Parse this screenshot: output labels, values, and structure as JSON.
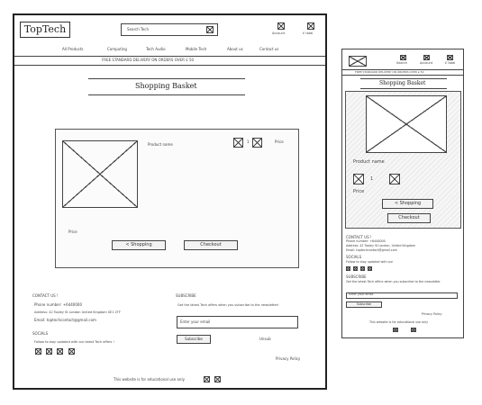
{
  "desktop": {
    "logo": "TopTech",
    "search_placeholder": "Search Tech",
    "account_label": "Account",
    "basket_label": "£ total",
    "nav": [
      "All Products",
      "Computing",
      "Tech Audio",
      "Mobile Tech",
      "About us",
      "Contact us"
    ],
    "banner": "FREE STANDARD DELIVERY ON ORDERS OVER £ 50",
    "page_title": "Shopping Basket",
    "product_name": "Product name",
    "qty_value": "1",
    "price_label": "Price",
    "price_bottom": "Price",
    "back_button": "< Shopping",
    "checkout_button": "Checkout",
    "contact_title": "CONTACT US !",
    "phone": "Phone number: +6440000",
    "address": "Address: 42 Tooley St London United Kingdom SE1 2TF",
    "email": "Email: toptechcontact@gmail.com",
    "socials_title": "SOCIALS",
    "socials_text": "Follow to stay updated with our latest Tech offers !",
    "subscribe_title": "SUBSCRIBE",
    "subscribe_text": "Get the latest Tech offers when you subscribe to the newsletter!",
    "email_placeholder": "Enter your email",
    "subscribe_button": "Subscribe",
    "unsub": "Unsub",
    "privacy": "Privacy Policy",
    "disclaimer": "This website is for educational use only"
  },
  "mobile": {
    "search_label": "Search",
    "account_label": "Account",
    "basket_label": "£ total",
    "banner": "FREE STANDARD DELIVERY ON ORDERS OVER £ 50",
    "page_title": "Shopping Basket",
    "product_name": "Product name",
    "qty_value": "1",
    "price_label": "Price",
    "back_button": "< Shopping",
    "checkout_button": "Checkout",
    "contact_title": "CONTACT US !",
    "phone": "Phone number: +6440000",
    "address": "Address: 42 Tooley St London, United Kingdom",
    "email": "Email: toptechcontact@gmail.com",
    "socials_title": "SOCIALS",
    "socials_text": "Follow to stay updated with our",
    "subscribe_title": "SUBSCRIBE",
    "subscribe_text": "Get the latest Tech offers when you subscribe to the newsletter",
    "email_placeholder": "Enter your email",
    "subscribe_button": "Subscribe",
    "privacy": "Privacy Policy",
    "disclaimer": "This website is for educational use only"
  }
}
